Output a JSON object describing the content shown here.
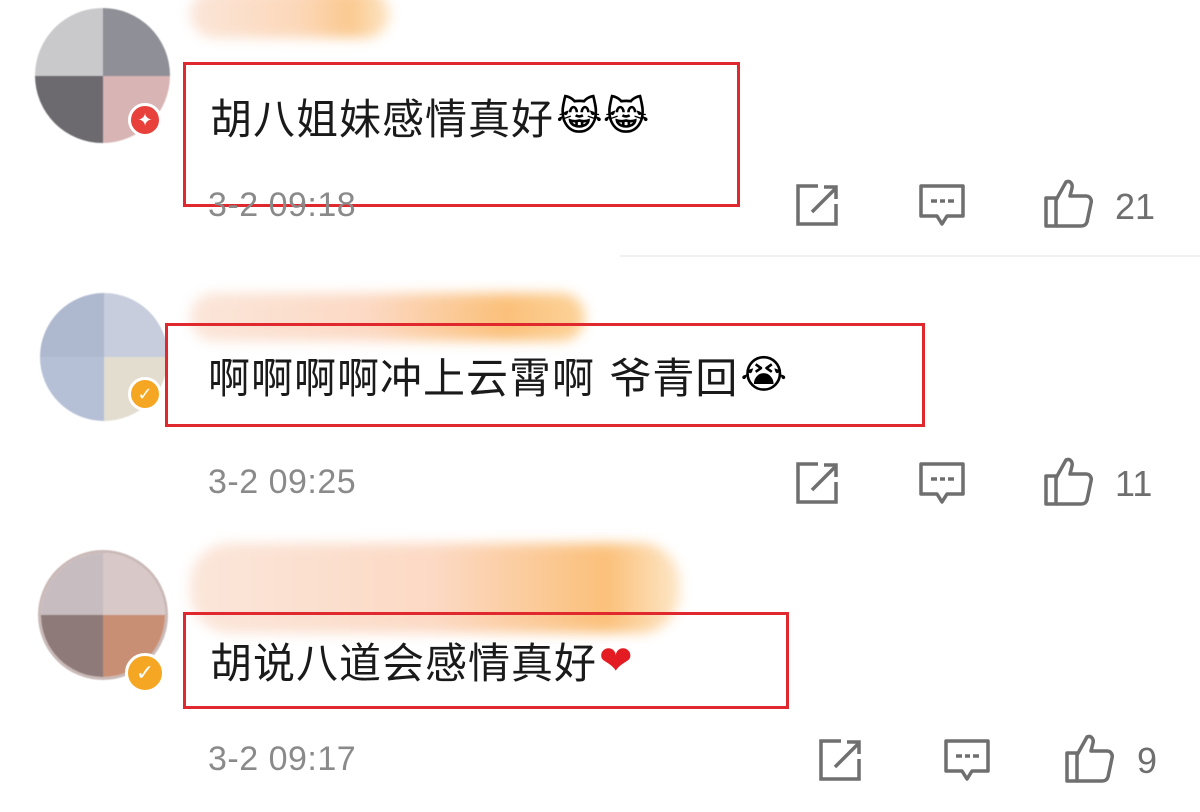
{
  "comments": [
    {
      "text": "胡八姐妹感情真好",
      "emoji": "😹😹",
      "timestamp": "3-2 09:18",
      "likes": "21",
      "badge": "red",
      "icons": {
        "share": "share-icon",
        "reply": "comment-icon",
        "like": "thumbs-up-icon"
      }
    },
    {
      "text": "啊啊啊啊冲上云霄啊 爷青回",
      "emoji": "😭",
      "timestamp": "3-2 09:25",
      "likes": "11",
      "badge": "gold",
      "icons": {
        "share": "share-icon",
        "reply": "comment-icon",
        "like": "thumbs-up-icon"
      }
    },
    {
      "text": "胡说八道会感情真好",
      "emoji": "❤",
      "timestamp": "3-2 09:17",
      "likes": "9",
      "badge": "gold-check",
      "icons": {
        "share": "share-icon",
        "reply": "comment-icon",
        "like": "thumbs-up-icon"
      }
    }
  ],
  "colors": {
    "highlight_box": "#e0292f",
    "timestamp": "#8a8a8a",
    "icon": "#6f6f6f",
    "badge_red": "#e8403a",
    "badge_gold": "#f5a623"
  }
}
